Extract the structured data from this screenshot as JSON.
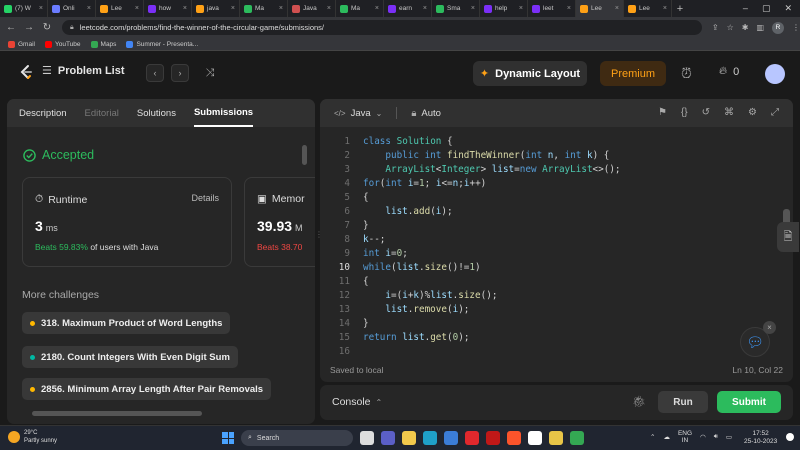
{
  "browser": {
    "tabs": [
      {
        "label": "(7) W",
        "color": "#25d366"
      },
      {
        "label": "Onli",
        "color": "#6b7cff"
      },
      {
        "label": "Lee",
        "color": "#ffa116"
      },
      {
        "label": "how",
        "color": "#7b2ff7"
      },
      {
        "label": "java",
        "color": "#ffa116"
      },
      {
        "label": "Ma",
        "color": "#2cbb5d"
      },
      {
        "label": "Java",
        "color": "#d05050"
      },
      {
        "label": "Ma",
        "color": "#2cbb5d"
      },
      {
        "label": "earn",
        "color": "#7b2ff7"
      },
      {
        "label": "Sma",
        "color": "#2cbb5d"
      },
      {
        "label": "help",
        "color": "#7b2ff7"
      },
      {
        "label": "leet",
        "color": "#7b2ff7"
      },
      {
        "label": "Lee",
        "color": "#ffa116"
      },
      {
        "label": "Lee",
        "color": "#ffa116"
      }
    ],
    "active_tab_index": 12,
    "url": "leetcode.com/problems/find-the-winner-of-the-circular-game/submissions/",
    "profile_initial": "R",
    "bookmarks": [
      {
        "label": "Gmail",
        "color": "#ea4335"
      },
      {
        "label": "YouTube",
        "color": "#ff0000"
      },
      {
        "label": "Maps",
        "color": "#34a853"
      },
      {
        "label": "Summer - Presenta...",
        "color": "#4285f4"
      }
    ]
  },
  "nav": {
    "problem_list": "Problem List",
    "dynamic_layout": "Dynamic Layout",
    "premium": "Premium",
    "streak": "0"
  },
  "left": {
    "tabs": [
      {
        "label": "Description",
        "state": "normal"
      },
      {
        "label": "Editorial",
        "state": "dim"
      },
      {
        "label": "Solutions",
        "state": "normal"
      },
      {
        "label": "Submissions",
        "state": "active"
      }
    ],
    "status": "Accepted",
    "runtime": {
      "title": "Runtime",
      "details": "Details",
      "value": "3",
      "unit": "ms",
      "beats_pct": "Beats 59.83%",
      "beats_text": "of users with Java"
    },
    "memory": {
      "title": "Memor",
      "value": "39.93",
      "unit": "M",
      "beats_pct": "Beats 38.70"
    },
    "more_challenges": "More challenges",
    "challenges": [
      {
        "label": "318. Maximum Product of Word Lengths",
        "color": "#ffb800"
      },
      {
        "label": "2180. Count Integers With Even Digit Sum",
        "color": "#00b8a3"
      },
      {
        "label": "2856. Minimum Array Length After Pair Removals",
        "color": "#ffb800"
      }
    ]
  },
  "editor": {
    "language": "Java",
    "mode": "Auto",
    "current_line": 10,
    "lines": [
      "class Solution {",
      "    public int findTheWinner(int n, int k) {",
      "    ArrayList<Integer> list=new ArrayList<>();",
      "for(int i=1; i<=n;i++)",
      "{",
      "    list.add(i);",
      "}",
      "k--;",
      "int i=0;",
      "while(list.size()!=1)",
      "{",
      "    i=(i+k)%list.size();",
      "    list.remove(i);",
      "}",
      "return list.get(0);",
      ""
    ],
    "saved": "Saved to local",
    "cursor": "Ln 10, Col 22"
  },
  "console": {
    "label": "Console",
    "run": "Run",
    "submit": "Submit"
  },
  "taskbar": {
    "temp": "29°C",
    "weather": "Partly sunny",
    "search": "Search",
    "lang": "ENG",
    "region": "IN",
    "time": "17:52",
    "date": "25-10-2023"
  }
}
